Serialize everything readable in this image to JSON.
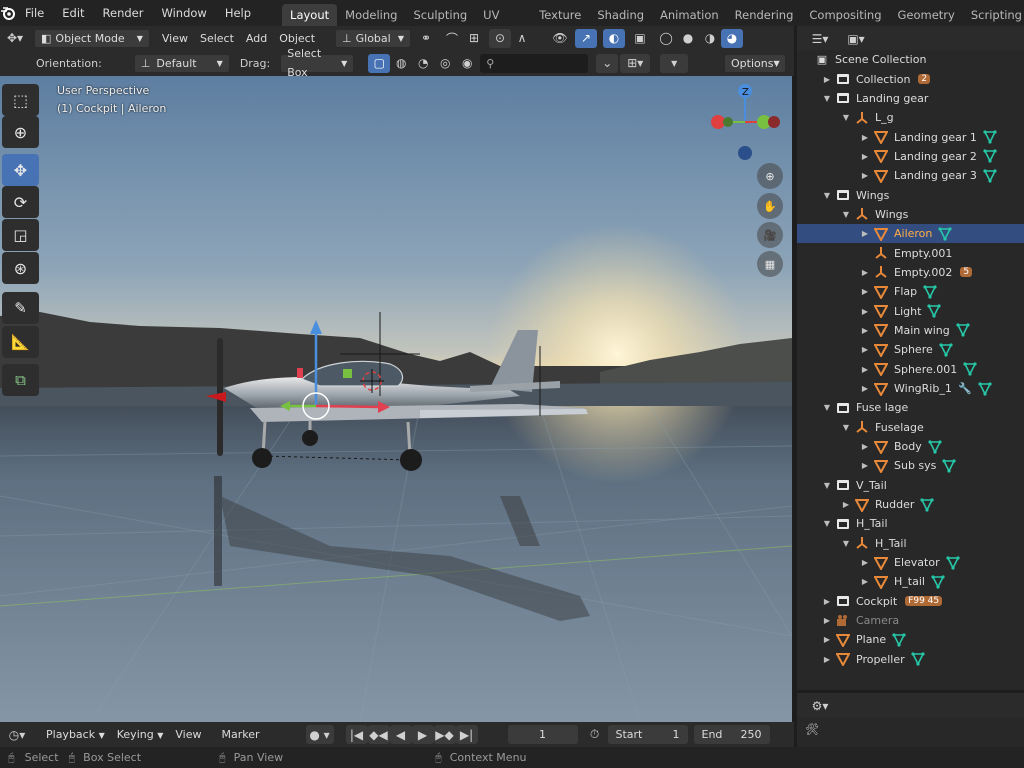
{
  "menus": [
    "File",
    "Edit",
    "Render",
    "Window",
    "Help"
  ],
  "workspaces": [
    "Layout",
    "Modeling",
    "Sculpting",
    "UV Editing",
    "Texture Paint",
    "Shading",
    "Animation",
    "Rendering",
    "Compositing",
    "Geometry Nodes",
    "Scripting"
  ],
  "active_workspace": "Layout",
  "header": {
    "mode": "Object Mode",
    "view": "View",
    "select": "Select",
    "add": "Add",
    "object": "Object",
    "transform_orientation": "Global"
  },
  "tool_header": {
    "orientation_label": "Orientation:",
    "orientation_value": "Default",
    "drag_label": "Drag:",
    "drag_value": "Select Box",
    "search_placeholder": "",
    "options": "Options"
  },
  "viewport": {
    "perspective": "User Perspective",
    "active_object": "(1) Cockpit | Aileron",
    "gizmo_z": "Z"
  },
  "outliner": {
    "scene": "Scene Collection",
    "rows": [
      {
        "label": "Collection",
        "depth": 1,
        "icon": "collection",
        "badge": "2"
      },
      {
        "label": "Landing gear",
        "depth": 1,
        "icon": "collection",
        "expanded": true
      },
      {
        "label": "L_g",
        "depth": 2,
        "icon": "empty",
        "expanded": true
      },
      {
        "label": "Landing gear 1",
        "depth": 3,
        "icon": "mesh",
        "mod": "mesh-data"
      },
      {
        "label": "Landing gear 2",
        "depth": 3,
        "icon": "mesh",
        "mod": "mesh-data"
      },
      {
        "label": "Landing gear 3",
        "depth": 3,
        "icon": "mesh",
        "mod": "mesh-data"
      },
      {
        "label": "Wings",
        "depth": 1,
        "icon": "collection",
        "expanded": true
      },
      {
        "label": "Wings",
        "depth": 2,
        "icon": "empty",
        "expanded": true
      },
      {
        "label": "Aileron",
        "depth": 3,
        "icon": "mesh",
        "mod": "mesh-data",
        "selected": true
      },
      {
        "label": "Empty.001",
        "depth": 3,
        "icon": "empty",
        "noexp": true
      },
      {
        "label": "Empty.002",
        "depth": 3,
        "icon": "empty",
        "badge": "5"
      },
      {
        "label": "Flap",
        "depth": 3,
        "icon": "mesh",
        "mod": "mesh-data"
      },
      {
        "label": "Light",
        "depth": 3,
        "icon": "mesh",
        "mod": "mesh-data"
      },
      {
        "label": "Main wing",
        "depth": 3,
        "icon": "mesh",
        "mod": "mesh-data"
      },
      {
        "label": "Sphere",
        "depth": 3,
        "icon": "mesh",
        "mod": "mesh-data"
      },
      {
        "label": "Sphere.001",
        "depth": 3,
        "icon": "mesh",
        "mod": "mesh-data"
      },
      {
        "label": "WingRib_1",
        "depth": 3,
        "icon": "mesh",
        "mod": "wrench"
      },
      {
        "label": "Fuse lage",
        "depth": 1,
        "icon": "collection",
        "expanded": true
      },
      {
        "label": "Fuselage",
        "depth": 2,
        "icon": "empty",
        "expanded": true
      },
      {
        "label": "Body",
        "depth": 3,
        "icon": "mesh",
        "mod": "mesh-data"
      },
      {
        "label": "Sub sys",
        "depth": 3,
        "icon": "mesh",
        "mod": "mesh-data"
      },
      {
        "label": "V_Tail",
        "depth": 1,
        "icon": "collection",
        "expanded": true
      },
      {
        "label": "Rudder",
        "depth": 2,
        "icon": "mesh",
        "mod": "mesh-data"
      },
      {
        "label": "H_Tail",
        "depth": 1,
        "icon": "collection",
        "expanded": true
      },
      {
        "label": "H_Tail",
        "depth": 2,
        "icon": "empty",
        "expanded": true
      },
      {
        "label": "Elevator",
        "depth": 3,
        "icon": "mesh",
        "mod": "mesh-data"
      },
      {
        "label": "H_tail",
        "depth": 3,
        "icon": "mesh",
        "mod": "mesh-data"
      },
      {
        "label": "Cockpit",
        "depth": 1,
        "icon": "collection",
        "badge": "F99 45"
      },
      {
        "label": "Camera",
        "depth": 1,
        "icon": "camera",
        "dim": true
      },
      {
        "label": "Plane",
        "depth": 1,
        "icon": "mesh",
        "mod": "mesh-data"
      },
      {
        "label": "Propeller",
        "depth": 1,
        "icon": "mesh",
        "mod": "mesh-data"
      }
    ]
  },
  "timeline": {
    "playback": "Playback",
    "keying": "Keying",
    "view": "View",
    "marker": "Marker",
    "current_frame": "1",
    "start_label": "Start",
    "start": "1",
    "end_label": "End",
    "end": "250"
  },
  "status": {
    "select": "Select",
    "box_select": "Box Select",
    "pan_view": "Pan View",
    "context_menu": "Context Menu"
  },
  "colors": {
    "accent": "#4772b3",
    "selection": "#334d80",
    "mesh_orange": "#e8893a",
    "mesh_green": "#26c7a8",
    "active_text": "#ffad49"
  }
}
